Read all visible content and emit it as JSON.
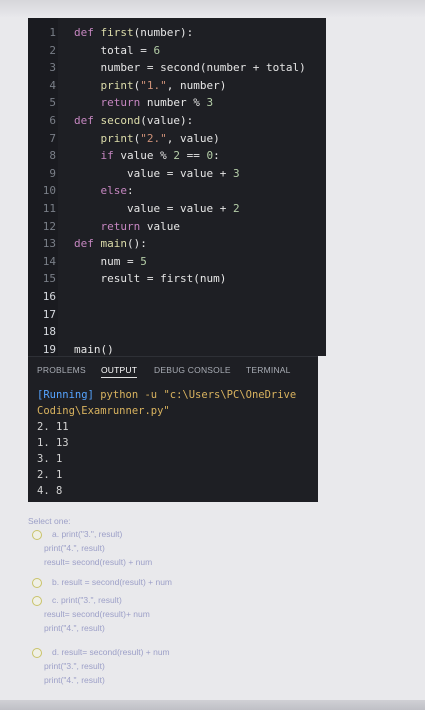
{
  "code_lines": [
    {
      "n": "1",
      "html": "<span class='kw'>def</span> <span class='fn'>first</span>(number):"
    },
    {
      "n": "2",
      "html": "    total = <span class='num'>6</span>"
    },
    {
      "n": "3",
      "html": "    number = second(number + total)"
    },
    {
      "n": "4",
      "html": "    <span class='fn'>print</span>(<span class='str'>\"1.\"</span>, number)"
    },
    {
      "n": "5",
      "html": "    <span class='kw'>return</span> number % <span class='num'>3</span>"
    },
    {
      "n": "6",
      "html": "<span class='kw'>def</span> <span class='fn'>second</span>(value):"
    },
    {
      "n": "7",
      "html": "    <span class='fn'>print</span>(<span class='str'>\"2.\"</span>, value)"
    },
    {
      "n": "8",
      "html": "    <span class='kw'>if</span> value % <span class='num'>2</span> == <span class='num'>0</span>:"
    },
    {
      "n": "9",
      "html": "        value = value + <span class='num'>3</span>"
    },
    {
      "n": "10",
      "html": "    <span class='kw'>else</span>:"
    },
    {
      "n": "11",
      "html": "        value = value + <span class='num'>2</span>"
    },
    {
      "n": "12",
      "html": "    <span class='kw'>return</span> value"
    },
    {
      "n": "13",
      "html": "<span class='kw'>def</span> <span class='fn'>main</span>():"
    },
    {
      "n": "14",
      "html": "    num = <span class='num'>5</span>"
    },
    {
      "n": "15",
      "html": "    result = first(num)"
    },
    {
      "n": "16",
      "html": ""
    },
    {
      "n": "17",
      "html": ""
    },
    {
      "n": "18",
      "html": ""
    },
    {
      "n": "19",
      "html": "main()"
    }
  ],
  "panel": {
    "tabs": [
      "PROBLEMS",
      "OUTPUT",
      "DEBUG CONSOLE",
      "TERMINAL"
    ],
    "active_tab": "OUTPUT",
    "running": "[Running]",
    "cmd1": " python -u \"c:\\Users\\PC\\OneDrive",
    "cmd2": "Coding\\Examrunner.py\"",
    "outputs": [
      "2. 11",
      "1. 13",
      "3. 1",
      "2. 1",
      "4. 8"
    ]
  },
  "question": {
    "prompt": "Select one:",
    "a": [
      "a. print(\"3.\", result)",
      "print(\"4.\", result)",
      "result= second(result) + num"
    ],
    "b": [
      "b. result = second(result) + num"
    ],
    "c": [
      "c. print(\"3.\", result)",
      "result= second(result)+ num",
      "print(\"4.\", result)"
    ],
    "d": [
      "d. result= second(result) + num",
      "print(\"3.\", result)",
      "print(\"4.\", result)"
    ]
  }
}
